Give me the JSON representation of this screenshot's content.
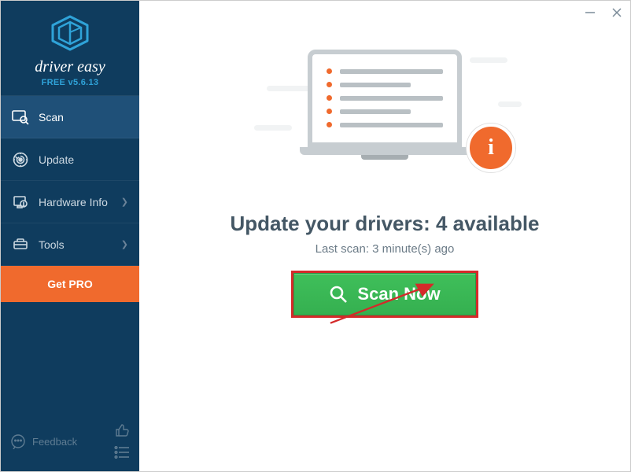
{
  "brand": {
    "name": "driver easy",
    "edition": "FREE v5.6.13"
  },
  "sidebar": {
    "items": [
      {
        "label": "Scan",
        "icon": "scan-icon",
        "active": true,
        "chevron": false
      },
      {
        "label": "Update",
        "icon": "update-icon",
        "active": false,
        "chevron": false
      },
      {
        "label": "Hardware Info",
        "icon": "hardware-icon",
        "active": false,
        "chevron": true
      },
      {
        "label": "Tools",
        "icon": "tools-icon",
        "active": false,
        "chevron": true
      }
    ],
    "get_pro_label": "Get PRO",
    "feedback_label": "Feedback"
  },
  "main": {
    "headline_prefix": "Update your drivers: ",
    "headline_count": "4 available",
    "last_scan": "Last scan: 3 minute(s) ago",
    "scan_button_label": "Scan Now"
  },
  "colors": {
    "sidebar": "#0f3c5e",
    "accent": "#f06a2d",
    "scan": "#3ab953",
    "highlight": "#d42a2a"
  }
}
